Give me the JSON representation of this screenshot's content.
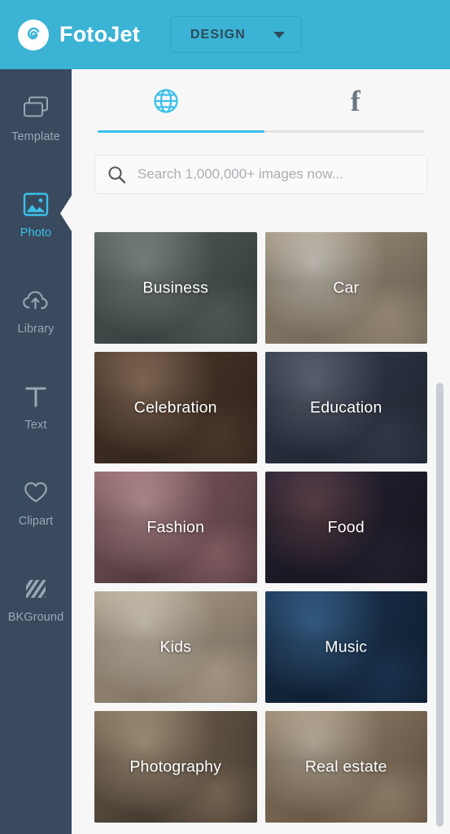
{
  "header": {
    "brand_name": "FotoJet",
    "logo_icon": "fotojet-swirl-logo",
    "design_button": {
      "label": "DESIGN",
      "caret_icon": "chevron-down-icon"
    },
    "background_color": "#3bb3d4"
  },
  "sidebar": {
    "background_color": "#394a5e",
    "active_color": "#3bc0ea",
    "items": [
      {
        "label": "Template",
        "icon": "template-stacked-rectangles-icon",
        "active": false
      },
      {
        "label": "Photo",
        "icon": "photo-image-icon",
        "active": true
      },
      {
        "label": "Library",
        "icon": "cloud-upload-icon",
        "active": false
      },
      {
        "label": "Text",
        "icon": "text-t-icon",
        "active": false
      },
      {
        "label": "Clipart",
        "icon": "heart-icon",
        "active": false
      },
      {
        "label": "BKGround",
        "icon": "diagonal-stripes-icon",
        "active": false
      }
    ]
  },
  "panel": {
    "background_color": "#f7f7f7",
    "tabs": [
      {
        "name": "web-images",
        "icon": "globe-icon",
        "active": true
      },
      {
        "name": "facebook",
        "icon": "facebook-f-icon",
        "label": "f",
        "active": false
      }
    ],
    "search": {
      "placeholder": "Search 1,000,000+ images now...",
      "value": "",
      "icon": "search-icon"
    },
    "categories": [
      {
        "label": "Business",
        "c1": "#5e6b68",
        "c2": "#2f3a3b",
        "c3": "#8f9a94"
      },
      {
        "label": "Car",
        "c1": "#b3a48c",
        "c2": "#6d6253",
        "c3": "#e3ddd3"
      },
      {
        "label": "Celebration",
        "c1": "#5a4335",
        "c2": "#2a1d17",
        "c3": "#9a7c64"
      },
      {
        "label": "Education",
        "c1": "#3b4455",
        "c2": "#1b2130",
        "c3": "#6c7485"
      },
      {
        "label": "Fashion",
        "c1": "#9d6f75",
        "c2": "#3b2a2e",
        "c3": "#cfa3a6"
      },
      {
        "label": "Food",
        "c1": "#2a2738",
        "c2": "#15131f",
        "c3": "#6b4a55"
      },
      {
        "label": "Kids",
        "c1": "#c6b69f",
        "c2": "#7d6e5c",
        "c3": "#e8decd"
      },
      {
        "label": "Music",
        "c1": "#1f3c5e",
        "c2": "#0b1726",
        "c3": "#3f6f9e"
      },
      {
        "label": "Photography",
        "c1": "#8d7a63",
        "c2": "#2b2420",
        "c3": "#bda98d"
      },
      {
        "label": "Real estate",
        "c1": "#a9957c",
        "c2": "#5d4a38",
        "c3": "#d6c9b3"
      }
    ],
    "scrollbar": {
      "name": "vertical-scrollbar",
      "color": "#c8cdd7"
    }
  }
}
